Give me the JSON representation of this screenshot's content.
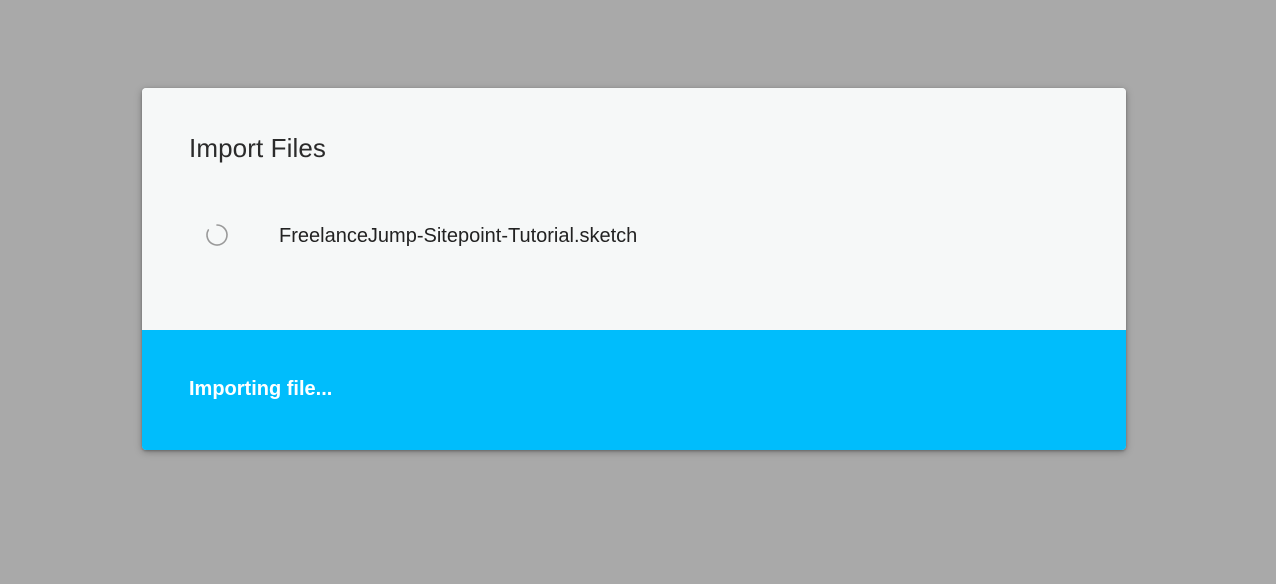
{
  "dialog": {
    "title": "Import Files",
    "files": [
      {
        "name": "FreelanceJump-Sitepoint-Tutorial.sketch",
        "status_icon": "loading-spinner-icon"
      }
    ],
    "footer": {
      "status": "Importing file...",
      "background_color": "#00bdfc"
    }
  },
  "colors": {
    "backdrop": "#a9a9a9",
    "dialog_bg": "#f6f8f8",
    "accent": "#00bdfc"
  }
}
